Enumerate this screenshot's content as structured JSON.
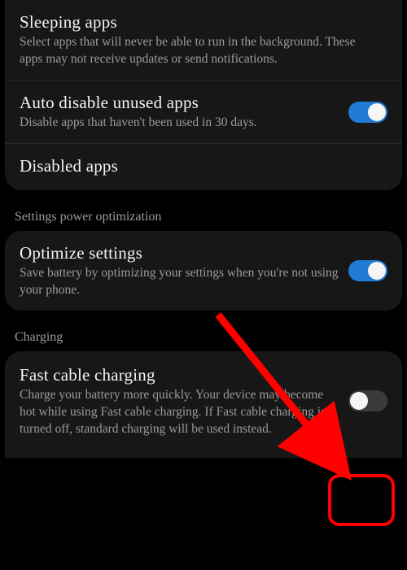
{
  "card1": {
    "sleeping": {
      "title": "Sleeping apps",
      "desc": "Select apps that will never be able to run in the background. These apps may not receive updates or send notifications."
    },
    "autodisable": {
      "title": "Auto disable unused apps",
      "desc": "Disable apps that haven't been used in 30 days.",
      "toggle": true
    },
    "disabled": {
      "title": "Disabled apps"
    }
  },
  "section_power": "Settings power optimization",
  "card2": {
    "optimize": {
      "title": "Optimize settings",
      "desc": "Save battery by optimizing your settings when you're not using your phone.",
      "toggle": true
    }
  },
  "section_charging": "Charging",
  "card3": {
    "fastcable": {
      "title": "Fast cable charging",
      "desc": "Charge your battery more quickly. Your device may become hot while using Fast cable charging. If Fast cable charging is turned off, standard charging will be used instead.",
      "toggle": false
    }
  }
}
